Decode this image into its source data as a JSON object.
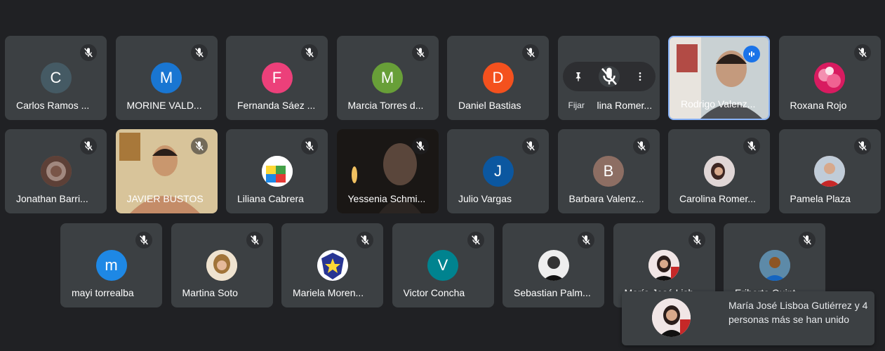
{
  "participants_row1": [
    {
      "name": "Carlos Ramos ...",
      "initial": "C",
      "color": "#455a64"
    },
    {
      "name": "MORINE VALD...",
      "initial": "M",
      "color": "#1976d2"
    },
    {
      "name": "Fernanda Sáez ...",
      "initial": "F",
      "color": "#ec407a"
    },
    {
      "name": "Marcia Torres d...",
      "initial": "M",
      "color": "#689f38"
    },
    {
      "name": "Daniel Bastias",
      "initial": "D",
      "color": "#f4511e"
    },
    {
      "name": "lina Romer...",
      "initial": "",
      "color": "#3c4043"
    },
    {
      "name": "Rodrigo Valenz...",
      "initial": "",
      "color": "#888"
    },
    {
      "name": "Roxana Rojo",
      "initial": "",
      "color": "#c2185b"
    }
  ],
  "participants_row2": [
    {
      "name": "Jonathan Barri...",
      "initial": "",
      "color": "#8d6e63"
    },
    {
      "name": "JAVIER BUSTOS",
      "initial": "",
      "color": "#c9a96e"
    },
    {
      "name": "Liliana Cabrera",
      "initial": "",
      "color": "#ffffff"
    },
    {
      "name": "Yessenia Schmi...",
      "initial": "",
      "color": "#1a1a1a"
    },
    {
      "name": "Julio Vargas",
      "initial": "J",
      "color": "#0b57a0"
    },
    {
      "name": "Barbara Valenz...",
      "initial": "B",
      "color": "#8d6e63"
    },
    {
      "name": "Carolina Romer...",
      "initial": "",
      "color": "#d9cfcf"
    },
    {
      "name": "Pamela Plaza",
      "initial": "",
      "color": "#b86a5a"
    }
  ],
  "participants_row3": [
    {
      "name": "mayi torrealba",
      "initial": "m",
      "color": "#1e88e5"
    },
    {
      "name": "Martina Soto",
      "initial": "",
      "color": "#e0c097"
    },
    {
      "name": "Mariela Moren...",
      "initial": "",
      "color": "#283593"
    },
    {
      "name": "Victor Concha",
      "initial": "V",
      "color": "#00838f"
    },
    {
      "name": "Sebastian Palm...",
      "initial": "",
      "color": "#222"
    },
    {
      "name": "María José Lisb...",
      "initial": "",
      "color": "#f1e6e6"
    },
    {
      "name": "Eriberto Quint...",
      "initial": "",
      "color": "#5d8aa8"
    }
  ],
  "pin_tooltip": "Fijar",
  "toast_text": "María José Lisboa Gutiérrez y 4 personas más se han unido",
  "colors": {
    "background": "#202124",
    "tile": "#3c4043",
    "accent": "#8ab4f8",
    "speaking": "#1a73e8"
  }
}
